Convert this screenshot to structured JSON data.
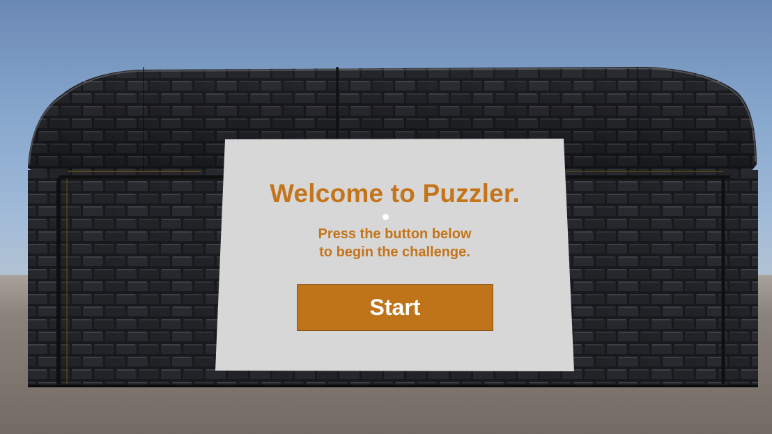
{
  "scene": {
    "sky_color": "#86a6cc",
    "ground_color": "#8a837c",
    "wall_color": "#1c1d20"
  },
  "panel": {
    "title": "Welcome to Puzzler.",
    "subtitle_line1": "Press the button below",
    "subtitle_line2": "to begin the challenge.",
    "text_color": "#c4741a",
    "background_color": "#d7d7d7"
  },
  "start_button": {
    "label": "Start",
    "background_color": "#bf741a",
    "text_color": "#ffffff"
  }
}
